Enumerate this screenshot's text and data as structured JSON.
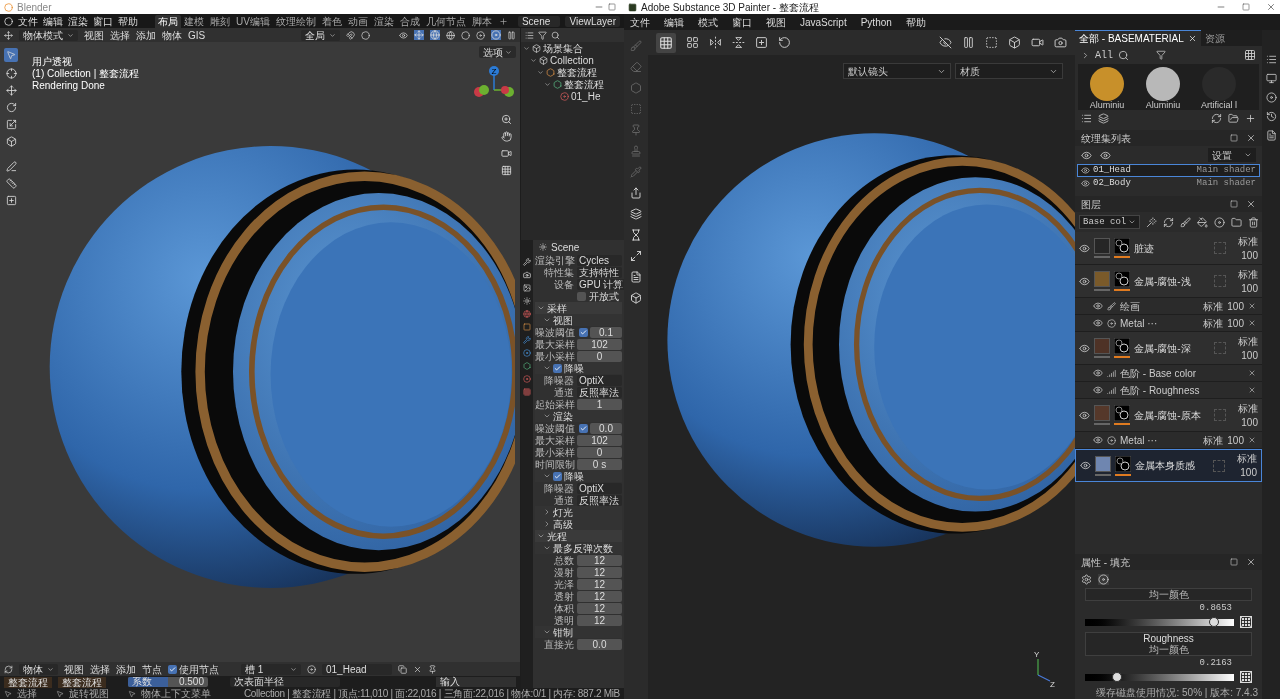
{
  "blender": {
    "title": "Blender",
    "menu": [
      "文件",
      "编辑",
      "渲染",
      "窗口",
      "帮助"
    ],
    "workspaces": [
      {
        "label": "布局",
        "selected": true
      },
      {
        "label": "建模",
        "selected": false
      },
      {
        "label": "雕刻",
        "selected": false
      },
      {
        "label": "UV编辑",
        "selected": false
      },
      {
        "label": "纹理绘制",
        "selected": false
      },
      {
        "label": "着色",
        "selected": false
      },
      {
        "label": "动画",
        "selected": false
      },
      {
        "label": "渲染",
        "selected": false
      },
      {
        "label": "合成",
        "selected": false
      },
      {
        "label": "几何节点",
        "selected": false
      },
      {
        "label": "脚本",
        "selected": false
      }
    ],
    "scene": "Scene",
    "view_layer": "ViewLayer",
    "mode": "物体模式",
    "view_menus": [
      "视图",
      "选择",
      "添加",
      "物体",
      "GIS"
    ],
    "orientation": "全局",
    "options": "选项",
    "overlay": [
      "用户透视",
      "(1) Collection | 整套流程",
      "Rendering Done"
    ],
    "gizmo_label": "Z",
    "outliner": [
      {
        "label": "场景集合",
        "kind": "scene",
        "expanded": true,
        "children": [
          {
            "label": "Collection",
            "kind": "collection",
            "expanded": true,
            "children": [
              {
                "label": "整套流程",
                "kind": "object",
                "expanded": true,
                "children": [
                  {
                    "label": "整套流程",
                    "kind": "mesh",
                    "expanded": true,
                    "children": [
                      {
                        "label": "01_He",
                        "kind": "material"
                      }
                    ]
                  }
                ]
              }
            ]
          }
        ]
      }
    ],
    "properties": {
      "context": "Scene",
      "rows": [
        {
          "kind": "dropdown",
          "label": "渲染引擎",
          "value": "Cycles"
        },
        {
          "kind": "dropdown",
          "label": "特性集",
          "value": "支持特性"
        },
        {
          "kind": "dropdown",
          "label": "设备",
          "value": "GPU 计算"
        },
        {
          "kind": "checkbox",
          "label": "开放式",
          "checked": false
        },
        {
          "kind": "panel",
          "label": "采样",
          "expanded": true
        },
        {
          "kind": "subpanel",
          "label": "视图",
          "expanded": true
        },
        {
          "kind": "checkfield",
          "label": "噪波阈值",
          "checked": true,
          "value": "0.1"
        },
        {
          "kind": "field",
          "label": "最大采样",
          "value": "102"
        },
        {
          "kind": "field",
          "label": "最小采样",
          "value": "0"
        },
        {
          "kind": "subpanel",
          "label": "降噪",
          "expanded": true,
          "checked": true
        },
        {
          "kind": "dropdown",
          "label": "降噪器",
          "value": "OptiX"
        },
        {
          "kind": "dropdown",
          "label": "通道",
          "value": "反照率法"
        },
        {
          "kind": "field",
          "label": "起始采样",
          "value": "1"
        },
        {
          "kind": "subpanel",
          "label": "渲染",
          "expanded": true
        },
        {
          "kind": "checkfield",
          "label": "噪波阈值",
          "checked": true,
          "value": "0.0"
        },
        {
          "kind": "field",
          "label": "最大采样",
          "value": "102"
        },
        {
          "kind": "field",
          "label": "最小采样",
          "value": "0"
        },
        {
          "kind": "field",
          "label": "时间限制",
          "value": "0 s"
        },
        {
          "kind": "subpanel",
          "label": "降噪",
          "expanded": true,
          "checked": true
        },
        {
          "kind": "dropdown",
          "label": "降噪器",
          "value": "OptiX"
        },
        {
          "kind": "dropdown",
          "label": "通道",
          "value": "反照率法"
        },
        {
          "kind": "subpanel",
          "label": "灯光",
          "expanded": false
        },
        {
          "kind": "subpanel",
          "label": "高级",
          "expanded": false
        },
        {
          "kind": "panel",
          "label": "光程",
          "expanded": true
        },
        {
          "kind": "subpanel",
          "label": "最多反弹次数",
          "expanded": true
        },
        {
          "kind": "field",
          "label": "总数",
          "value": "12"
        },
        {
          "kind": "field",
          "label": "漫射",
          "value": "12"
        },
        {
          "kind": "field",
          "label": "光泽",
          "value": "12"
        },
        {
          "kind": "field",
          "label": "透射",
          "value": "12"
        },
        {
          "kind": "field",
          "label": "体积",
          "value": "12"
        },
        {
          "kind": "field",
          "label": "透明",
          "value": "12"
        },
        {
          "kind": "subpanel",
          "label": "钳制",
          "expanded": true
        },
        {
          "kind": "field",
          "label": "直接光",
          "value": "0.0"
        }
      ]
    },
    "node_header": {
      "mode": "物体",
      "menus": [
        "视图",
        "选择",
        "添加",
        "节点"
      ],
      "use_nodes": {
        "label": "使用节点",
        "checked": true
      },
      "slot": "槽 1",
      "material": "01_Head"
    },
    "node_strip": {
      "nodes": [
        "整套流程",
        "整套流程"
      ],
      "factor": {
        "label": "系数",
        "value": "0.500",
        "level": 0.5
      },
      "subsurface": "次表面半径",
      "input": "输入"
    },
    "status": {
      "hints": [
        "选择",
        "旋转视图",
        "物体上下文菜单"
      ],
      "stats": "Collection | 整套流程 | 顶点:11,010 | 面:22,016 | 三角面:22,016 | 物体:0/1 | 内存: 887.2 MiB"
    }
  },
  "painter": {
    "title": "Adobe Substance 3D Painter - 整套流程",
    "menu": [
      "文件",
      "编辑",
      "模式",
      "窗口",
      "视图",
      "JavaScript",
      "Python",
      "帮助"
    ],
    "camera": "默认镜头",
    "view_mode": "材质",
    "gizmo": [
      "Y",
      "Z"
    ],
    "shelf_tabs": [
      {
        "label": "全部 - BASEMATERIAL",
        "selected": true
      },
      {
        "label": "资源",
        "selected": false
      }
    ],
    "breadcrumb": "All",
    "materials": [
      {
        "name": "Aluminiu",
        "color": "#c8902a"
      },
      {
        "name": "Aluminiu",
        "color": "#b8b8b8"
      },
      {
        "name": "Artificial l",
        "color": "#2a2a2a"
      }
    ],
    "texture_sets": {
      "title": "纹理集列表",
      "settings": "设置",
      "rows": [
        {
          "name": "01_Head",
          "shader": "Main shader",
          "selected": true
        },
        {
          "name": "02_Body",
          "shader": "Main shader",
          "selected": false
        }
      ]
    },
    "layers": {
      "title": "图层",
      "channel": "Base col",
      "items": [
        {
          "name": "脏迹",
          "blend": "标准",
          "opacity": "100",
          "color": "#262626",
          "selected": false
        },
        {
          "name": "金属-腐蚀-浅",
          "blend": "标准",
          "opacity": "100",
          "color": "#7a5a2a",
          "selected": false,
          "children": [
            {
              "kind": "paint",
              "name": "绘画",
              "blend": "标准",
              "opacity": "100"
            },
            {
              "kind": "generator",
              "name": "Metal ···",
              "blend": "标准",
              "opacity": "100"
            }
          ]
        },
        {
          "name": "金属-腐蚀-深",
          "blend": "标准",
          "opacity": "100",
          "color": "#4e3226",
          "selected": false,
          "children": [
            {
              "kind": "levels",
              "name": "色阶 - Base color"
            },
            {
              "kind": "levels",
              "name": "色阶 - Roughness"
            }
          ]
        },
        {
          "name": "金属-腐蚀-原本",
          "blend": "标准",
          "opacity": "100",
          "color": "#55382a",
          "selected": false,
          "children": [
            {
              "kind": "generator",
              "name": "Metal ···",
              "blend": "标准",
              "opacity": "100"
            }
          ]
        },
        {
          "name": "金属本身质感",
          "blend": "标准",
          "opacity": "100",
          "color": "#6f86b0",
          "selected": true
        }
      ]
    },
    "properties": {
      "title": "属性 - 填充",
      "channels": [
        {
          "mode": "均一颜色",
          "value": "0.8653",
          "level": 0.8653
        },
        {
          "label": "Roughness",
          "mode": "均一颜色",
          "value": "0.2163",
          "level": 0.2163
        }
      ]
    },
    "status": "缓存磁盘使用情况: 50% | 版本: 7.4.3"
  }
}
